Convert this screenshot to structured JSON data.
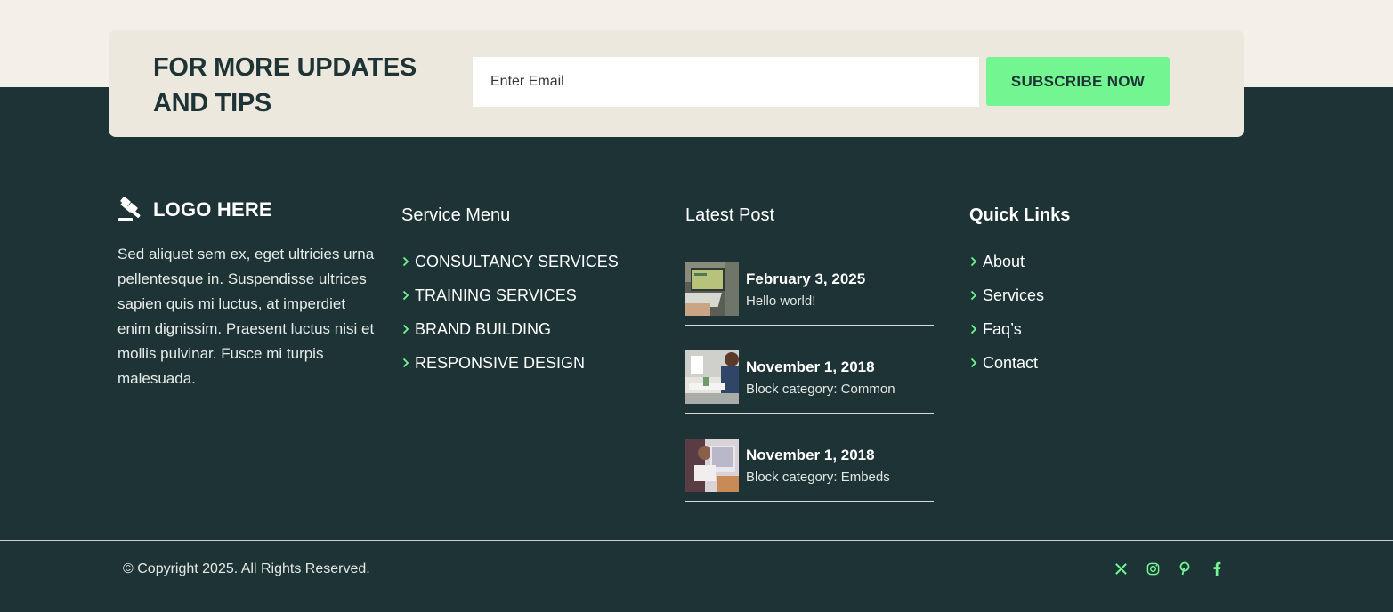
{
  "newsletter": {
    "title": "FOR MORE UPDATES AND TIPS",
    "email_placeholder": "Enter Email",
    "button_label": "SUBSCRIBE NOW"
  },
  "brand": {
    "logo_text": "LOGO HERE",
    "logo_icon": "gavel-icon",
    "description": "Sed aliquet sem ex, eget ultricies urna pellentesque in. Suspendisse ultrices sapien quis mi luctus, at imperdiet enim dignissim. Praesent luctus nisi et mollis pulvinar. Fusce mi turpis malesuada."
  },
  "service_menu": {
    "title": "Service Menu",
    "items": [
      {
        "label": "CONSULTANCY SERVICES"
      },
      {
        "label": "TRAINING SERVICES"
      },
      {
        "label": "BRAND BUILDING"
      },
      {
        "label": "RESPONSIVE DESIGN"
      }
    ]
  },
  "latest_post": {
    "title": "Latest Post",
    "posts": [
      {
        "date": "February 3, 2025",
        "title": "Hello world!"
      },
      {
        "date": "November 1, 2018",
        "title": "Block category: Common"
      },
      {
        "date": "November 1, 2018",
        "title": "Block category: Embeds"
      }
    ]
  },
  "quick_links": {
    "title": "Quick Links",
    "items": [
      {
        "label": "About"
      },
      {
        "label": "Services"
      },
      {
        "label": "Faq’s"
      },
      {
        "label": "Contact"
      }
    ]
  },
  "footer": {
    "copyright": "© Copyright 2025. All Rights Reserved.",
    "socials": [
      "x-icon",
      "instagram-icon",
      "pinterest-icon",
      "facebook-icon"
    ]
  },
  "colors": {
    "dark_green": "#1d3335",
    "accent_green": "#73f592",
    "cream": "#ede8dd"
  }
}
